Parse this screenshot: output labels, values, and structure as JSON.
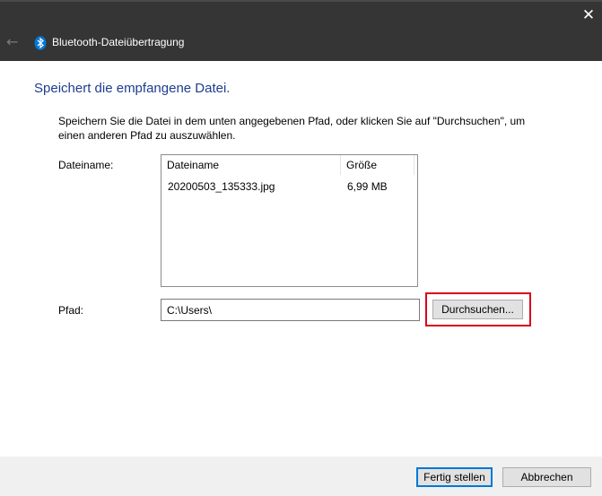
{
  "window": {
    "title": "Bluetooth-Dateiübertragung",
    "close_glyph": "✕",
    "back_glyph": "←",
    "icons": [
      "back-arrow-icon",
      "bluetooth-icon",
      "close-icon"
    ],
    "accent_color": "#0078d7",
    "bluetooth_color": "#0078d7",
    "highlight_color": "#d9001b"
  },
  "main": {
    "heading": "Speichert die empfangene Datei.",
    "description": "Speichern Sie die Datei in dem unten angegebenen Pfad, oder klicken Sie auf \"Durchsuchen\", um einen anderen Pfad zu auszuwählen.",
    "filename_label": "Dateiname:",
    "columns": [
      "Dateiname",
      "Größe"
    ],
    "files": [
      {
        "name": "20200503_135333.jpg",
        "size": "6,99 MB"
      }
    ],
    "path_label": "Pfad:",
    "path_value": "C:\\Users\\",
    "browse_label": "Durchsuchen..."
  },
  "footer": {
    "finish_label": "Fertig stellen",
    "cancel_label": "Abbrechen"
  }
}
